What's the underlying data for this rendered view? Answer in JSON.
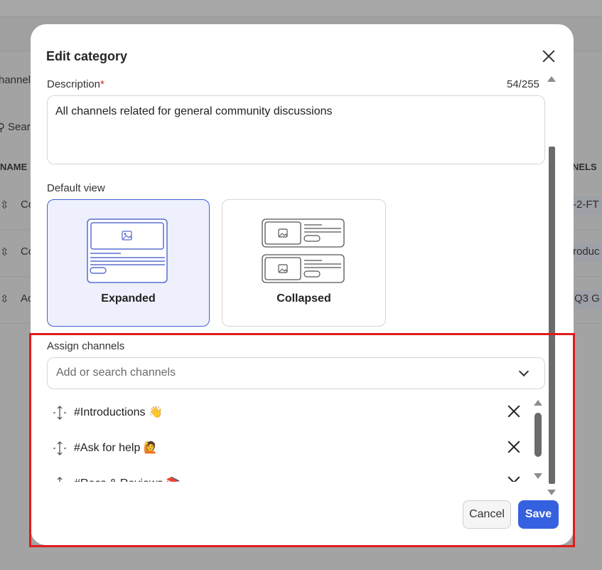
{
  "background": {
    "left_text": "hannels",
    "search_text": "Sear",
    "col_name": "NAME",
    "col_channels": "NELS",
    "rows": [
      {
        "name": "Co",
        "channels": "-2-FT"
      },
      {
        "name": "Co",
        "channels": "roduc"
      },
      {
        "name": "Ac",
        "channels": "Q3 G"
      }
    ]
  },
  "modal": {
    "title": "Edit category",
    "description": {
      "label": "Description",
      "required_mark": "*",
      "counter": "54/255",
      "value": "All channels related for general community discussions"
    },
    "default_view": {
      "label": "Default view",
      "options": [
        {
          "label": "Expanded",
          "selected": true
        },
        {
          "label": "Collapsed",
          "selected": false
        }
      ]
    },
    "assign_channels": {
      "label": "Assign channels",
      "placeholder": "Add or search channels",
      "channels": [
        {
          "name": "#Introductions 👋"
        },
        {
          "name": "#Ask for help 🙋"
        },
        {
          "name": "#Recs & Reviews 📚"
        }
      ]
    },
    "buttons": {
      "cancel": "Cancel",
      "save": "Save"
    }
  },
  "colors": {
    "accent": "#3561e0",
    "selected_border": "#3f5fd6",
    "selected_bg": "#eef1fd",
    "highlight": "#e01b1b",
    "overlay": "#a3a3a3"
  }
}
